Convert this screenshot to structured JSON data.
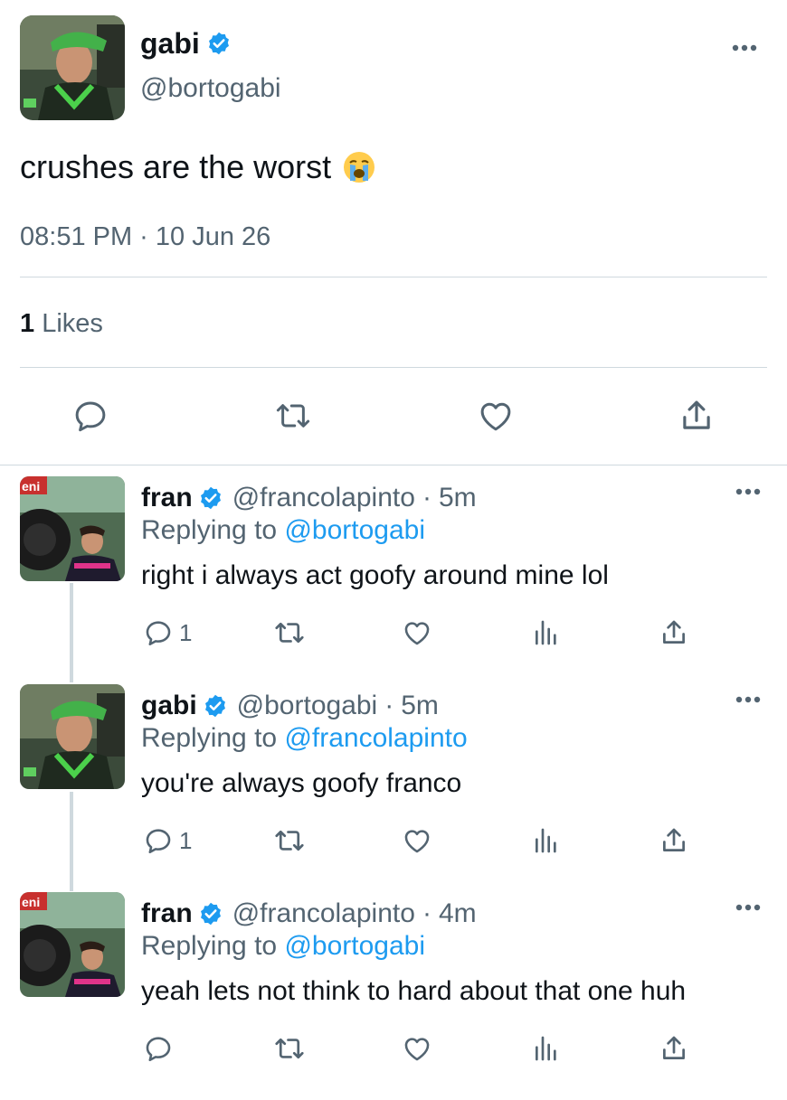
{
  "colors": {
    "accent": "#1d9bf0",
    "muted": "#536471",
    "text": "#0f1419",
    "divider": "#cfd9de"
  },
  "main_tweet": {
    "name": "gabi",
    "handle": "@bortogabi",
    "text": "crushes are the worst",
    "emoji": "loudly-crying-face-emoji",
    "timestamp": "08:51 PM · 10 Jun 26",
    "likes_count": "1",
    "likes_label": "Likes",
    "actions": [
      "reply-icon",
      "retweet-icon",
      "like-icon",
      "share-icon"
    ]
  },
  "replies": [
    {
      "name": "fran",
      "handle": "@francolapinto",
      "dot": "·",
      "time": "5m",
      "replying_prefix": "Replying to",
      "replying_to": "@bortogabi",
      "text": "right i always act goofy around mine lol",
      "reply_count": "1"
    },
    {
      "name": "gabi",
      "handle": "@bortogabi",
      "dot": "·",
      "time": "5m",
      "replying_prefix": "Replying to",
      "replying_to": "@francolapinto",
      "text": "you're always goofy franco",
      "reply_count": "1"
    },
    {
      "name": "fran",
      "handle": "@francolapinto",
      "dot": "·",
      "time": "4m",
      "replying_prefix": "Replying to",
      "replying_to": "@bortogabi",
      "text": "yeah lets not think to hard about that one huh",
      "reply_count": ""
    }
  ]
}
